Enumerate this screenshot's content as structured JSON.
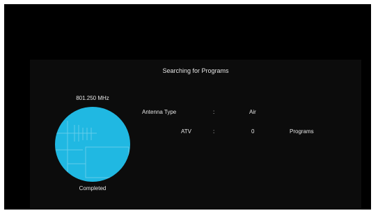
{
  "scan": {
    "title": "Searching for Programs",
    "frequency": "801.250 MHz",
    "status": "Completed"
  },
  "info": {
    "antenna_label": "Antenna Type",
    "antenna_sep": ":",
    "antenna_value": "Air",
    "atv_label": "ATV",
    "atv_sep": ":",
    "atv_value": "0",
    "atv_unit": "Programs"
  },
  "colors": {
    "accent": "#20b8e2",
    "background": "#000000",
    "panel": "#0c0c0c",
    "text": "#e6e6e6"
  }
}
